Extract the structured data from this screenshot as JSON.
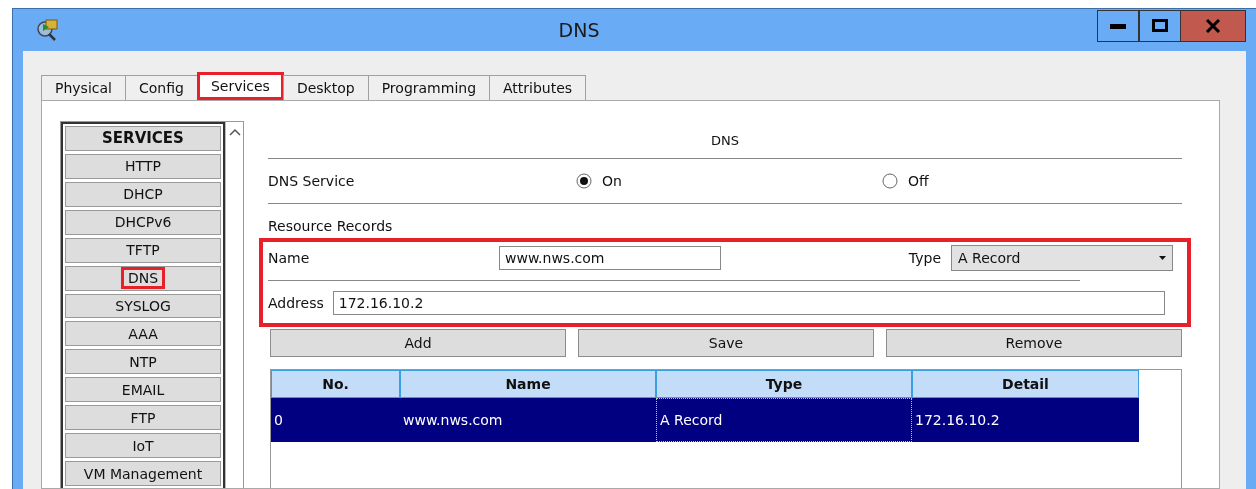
{
  "window": {
    "title": "DNS"
  },
  "tabs": [
    {
      "label": "Physical",
      "selected": false,
      "highlighted": false
    },
    {
      "label": "Config",
      "selected": false,
      "highlighted": false
    },
    {
      "label": "Services",
      "selected": true,
      "highlighted": true
    },
    {
      "label": "Desktop",
      "selected": false,
      "highlighted": false
    },
    {
      "label": "Programming",
      "selected": false,
      "highlighted": false
    },
    {
      "label": "Attributes",
      "selected": false,
      "highlighted": false
    }
  ],
  "sidebar": {
    "heading": "SERVICES",
    "items": [
      {
        "label": "HTTP",
        "highlighted": false
      },
      {
        "label": "DHCP",
        "highlighted": false
      },
      {
        "label": "DHCPv6",
        "highlighted": false
      },
      {
        "label": "TFTP",
        "highlighted": false
      },
      {
        "label": "DNS",
        "highlighted": true
      },
      {
        "label": "SYSLOG",
        "highlighted": false
      },
      {
        "label": "AAA",
        "highlighted": false
      },
      {
        "label": "NTP",
        "highlighted": false
      },
      {
        "label": "EMAIL",
        "highlighted": false
      },
      {
        "label": "FTP",
        "highlighted": false
      },
      {
        "label": "IoT",
        "highlighted": false
      },
      {
        "label": "VM Management",
        "highlighted": false
      }
    ]
  },
  "service": {
    "heading": "DNS",
    "label": "DNS Service",
    "options": [
      {
        "label": "On",
        "selected": true
      },
      {
        "label": "Off",
        "selected": false
      }
    ]
  },
  "records": {
    "label": "Resource Records",
    "highlighted": true,
    "name_label": "Name",
    "name": "www.nws.com",
    "type_label": "Type",
    "type": "A Record",
    "address_label": "Address",
    "address": "172.16.10.2"
  },
  "buttons": [
    "Add",
    "Save",
    "Remove"
  ],
  "table": {
    "columns": [
      "No.",
      "Name",
      "Type",
      "Detail"
    ],
    "rows": [
      {
        "cells": [
          "0",
          "www.nws.com",
          "A Record",
          "172.16.10.2"
        ],
        "selected": true
      }
    ]
  }
}
